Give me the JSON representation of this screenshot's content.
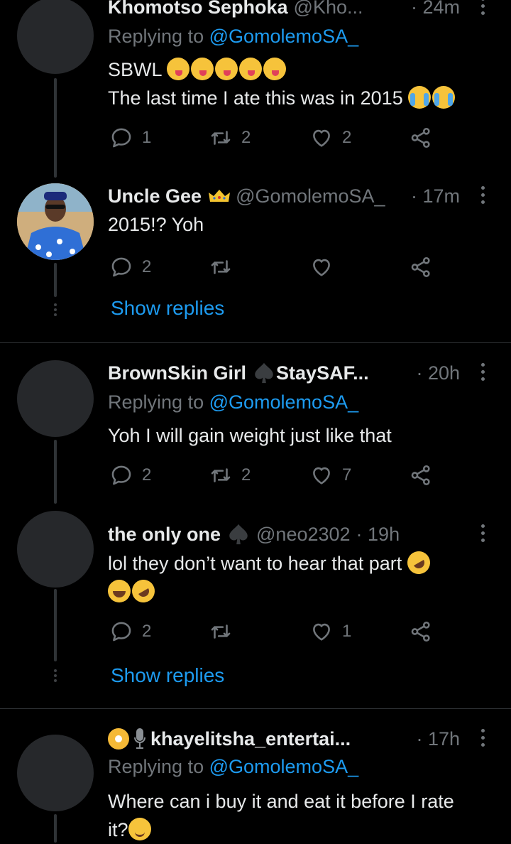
{
  "tweets": [
    {
      "name": "Khomotso Sephoka",
      "handle": "@Kho...",
      "time": "· 24m",
      "replying_label": "Replying to",
      "replying_handle": "@GomolemoSA_",
      "line1": "SBWL",
      "line2": "The last time I ate this was in 2015",
      "replies": "1",
      "retweets": "2",
      "likes": "2"
    },
    {
      "name": "Uncle Gee",
      "handle": "@GomolemoSA_",
      "time": "· 17m",
      "text": "2015!? Yoh",
      "replies": "2",
      "retweets": "",
      "likes": "",
      "show_replies": "Show replies"
    },
    {
      "name": "BrownSkin Girl",
      "name2": "StaySAF...",
      "time": "· 20h",
      "replying_label": "Replying to",
      "replying_handle": "@GomolemoSA_",
      "text": "Yoh I will gain weight just like that",
      "replies": "2",
      "retweets": "2",
      "likes": "7"
    },
    {
      "name": "the only one",
      "handle": "@neo2302",
      "time": "· 19h",
      "text": "lol they don’t want to hear that part",
      "replies": "2",
      "retweets": "",
      "likes": "1",
      "show_replies": "Show replies"
    },
    {
      "name": "khayelitsha_entertai...",
      "time": "· 17h",
      "replying_label": "Replying to",
      "replying_handle": "@GomolemoSA_",
      "text": "Where can i buy it and eat it before I rate",
      "text2": "it?"
    }
  ],
  "icons": {
    "reply": "reply-icon",
    "retweet": "retweet-icon",
    "like": "heart-icon",
    "share": "share-icon",
    "more": "more-icon"
  },
  "colors": {
    "accent": "#1d9bf0",
    "muted": "#71767b",
    "background": "#000000"
  }
}
